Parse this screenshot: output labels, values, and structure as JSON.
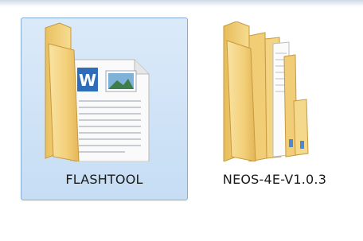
{
  "colors": {
    "selection_fill": "#c6ddf4",
    "selection_border": "#84acd9",
    "folder_yellow": "#f4d27a",
    "folder_dark": "#d9ab4a",
    "word_blue": "#2f6db8"
  },
  "items": [
    {
      "label": "FLASHTOOL",
      "icon": "folder-with-documents-icon",
      "selected": true
    },
    {
      "label": "NEOS-4E-V1.0.3",
      "icon": "folder-with-files-icon",
      "selected": false
    }
  ]
}
